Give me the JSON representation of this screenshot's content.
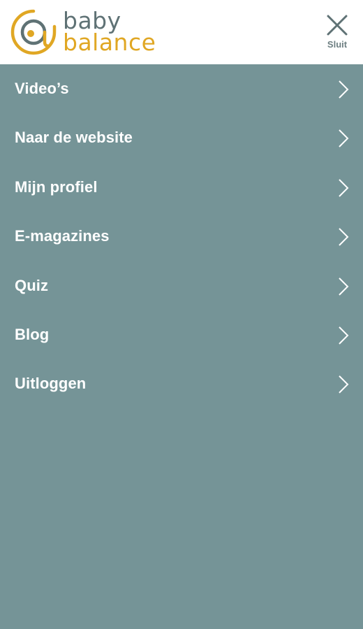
{
  "header": {
    "logo": {
      "line1": "baby",
      "line2": "balance",
      "icon": "baby-face-at-icon",
      "colors": {
        "gold": "#e0a724",
        "slate": "#5f7275"
      }
    },
    "close": {
      "icon": "close-icon",
      "label": "Sluit"
    }
  },
  "menu": {
    "background": "#759497",
    "items": [
      {
        "label": "Video’s",
        "icon": "chevron-right-icon"
      },
      {
        "label": "Naar de website",
        "icon": "chevron-right-icon"
      },
      {
        "label": "Mijn profiel",
        "icon": "chevron-right-icon"
      },
      {
        "label": "E-magazines",
        "icon": "chevron-right-icon"
      },
      {
        "label": "Quiz",
        "icon": "chevron-right-icon"
      },
      {
        "label": "Blog",
        "icon": "chevron-right-icon"
      },
      {
        "label": "Uitloggen",
        "icon": "chevron-right-icon"
      }
    ]
  }
}
